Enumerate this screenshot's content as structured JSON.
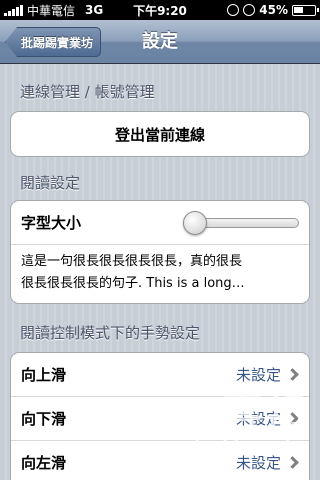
{
  "status_bar": {
    "carrier": "中華電信",
    "network": "3G",
    "time": "下午9:20",
    "battery_percent": "45%",
    "battery_level": 0.45
  },
  "nav": {
    "back_label": "批踢踢實業坊",
    "title": "設定"
  },
  "sections": {
    "connection": {
      "header": "連線管理 / 帳號管理",
      "logout_label": "登出當前連線"
    },
    "reading": {
      "header": "閱讀設定",
      "font_size_label": "字型大小",
      "font_size_level": 0,
      "preview_line1": "這是一句很長很長很長很長，真的很長",
      "preview_line2": "很長很長很長的句子. This is a long…"
    },
    "gestures": {
      "header": "閱讀控制模式下的手勢設定",
      "items": [
        {
          "label": "向上滑",
          "value": "未設定"
        },
        {
          "label": "向下滑",
          "value": "未設定"
        },
        {
          "label": "向左滑",
          "value": "未設定"
        }
      ]
    }
  },
  "watermark": {
    "logo": "T客邦",
    "domain": "techbang.tw"
  },
  "colors": {
    "nav_bar": "#6f86a6",
    "value_text": "#385487",
    "background": "#c5ccd4"
  }
}
